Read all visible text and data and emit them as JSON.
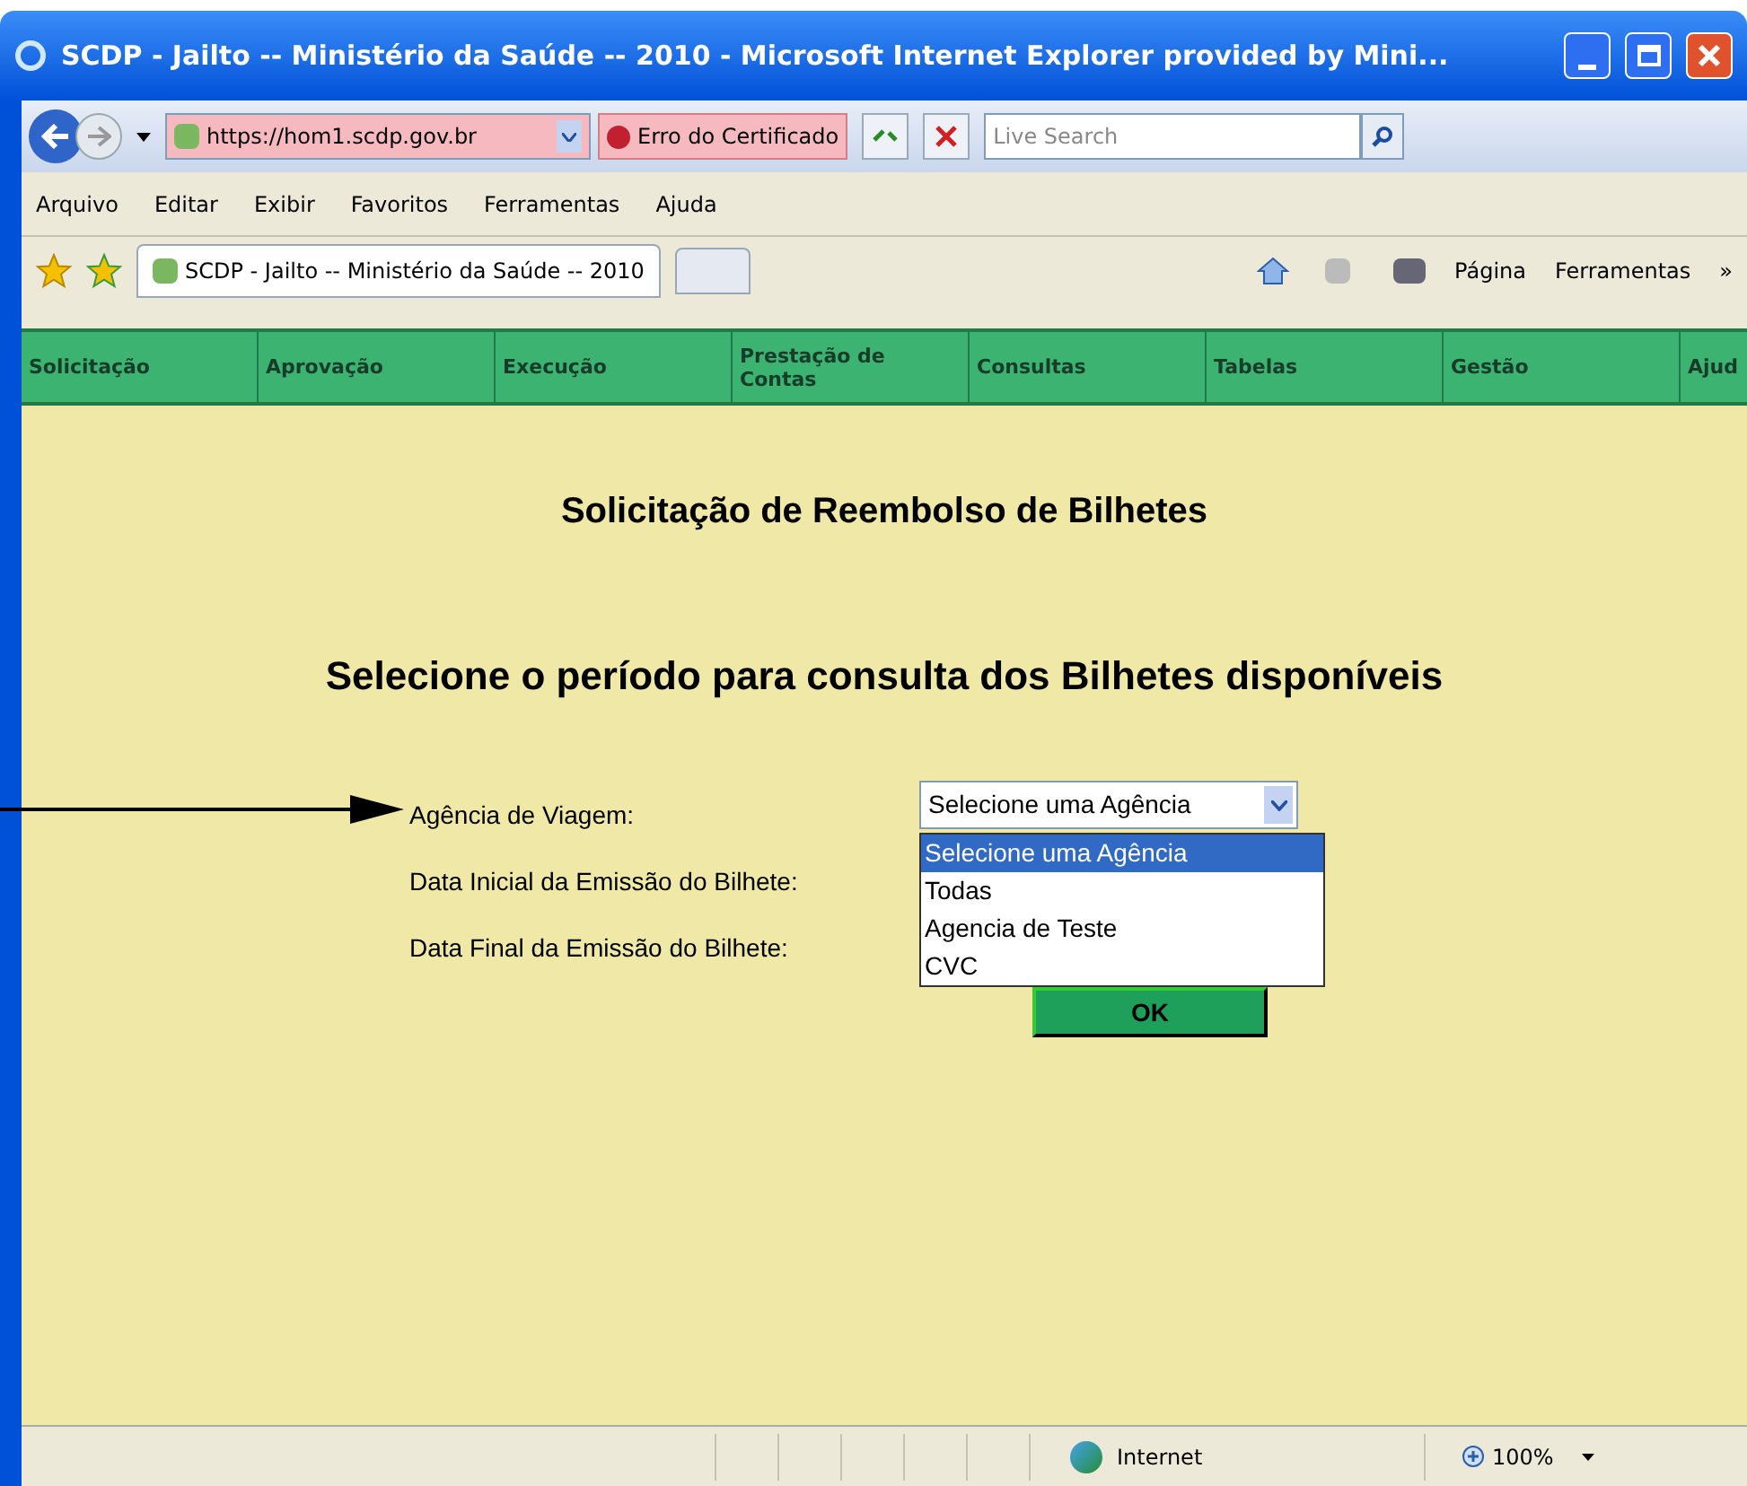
{
  "window": {
    "title": "SCDP - Jailto -- Ministério da Saúde -- 2010 - Microsoft Internet Explorer provided by Mini..."
  },
  "address_bar": {
    "url": "https://hom1.scdp.gov.br",
    "certificate": "Erro do Certificado",
    "search_placeholder": "Live Search"
  },
  "menu": [
    "Arquivo",
    "Editar",
    "Exibir",
    "Favoritos",
    "Ferramentas",
    "Ajuda"
  ],
  "tabs": [
    {
      "label": "SCDP - Jailto -- Ministério da Saúde -- 2010",
      "selected": true
    }
  ],
  "command_bar": [
    "Página",
    "Ferramentas",
    "»"
  ],
  "nav": [
    "Solicitação",
    "Aprovação",
    "Execução",
    "Prestação de Contas",
    "Consultas",
    "Tabelas",
    "Gestão",
    "Ajud"
  ],
  "page": {
    "title": "Solicitação de Reembolso de Bilhetes",
    "subtitle": "Selecione o período para consulta dos Bilhetes disponíveis",
    "labels": [
      "Agência de Viagem:",
      "Data Inicial da Emissão do Bilhete:",
      "Data Final da Emissão do Bilhete:"
    ],
    "select": {
      "value": "Selecione uma Agência",
      "options": [
        {
          "label": "Selecione uma Agência",
          "selected": true
        },
        {
          "label": "Todas",
          "selected": false
        },
        {
          "label": "Agencia de Teste",
          "selected": false
        },
        {
          "label": "CVC",
          "selected": false
        }
      ]
    },
    "button": "OK"
  },
  "status_bar": {
    "zone": "Internet",
    "zoom": "100%"
  }
}
